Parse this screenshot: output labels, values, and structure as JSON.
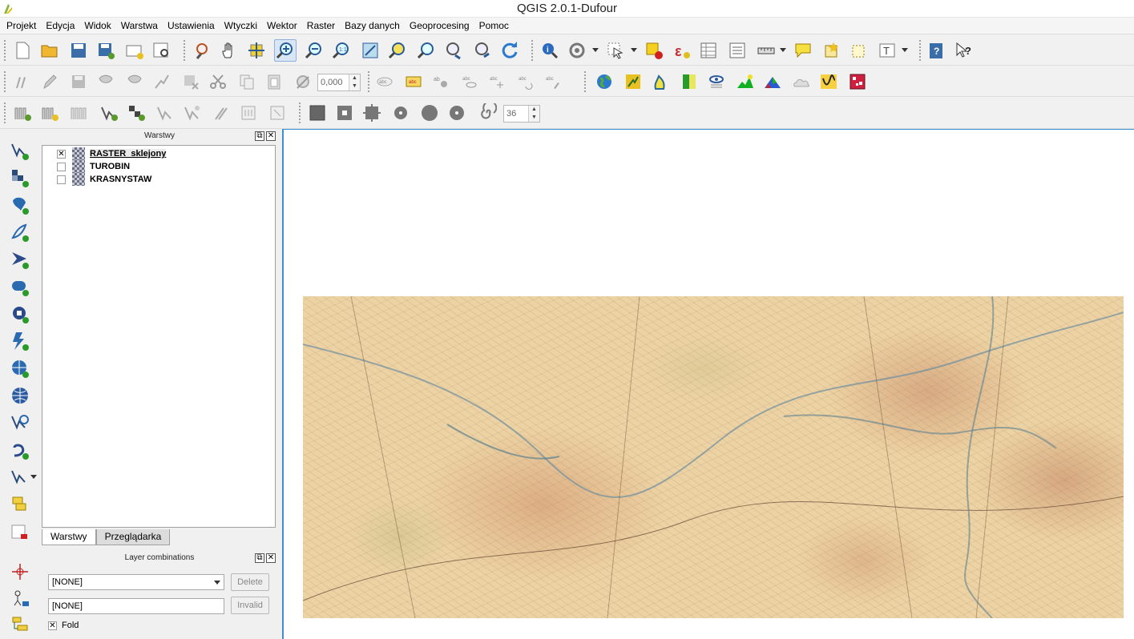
{
  "window": {
    "title": "QGIS 2.0.1-Dufour"
  },
  "menu": [
    "Projekt",
    "Edycja",
    "Widok",
    "Warstwa",
    "Ustawienia",
    "Wtyczki",
    "Wektor",
    "Raster",
    "Bazy danych",
    "Geoprocesing",
    "Pomoc"
  ],
  "toolbar": {
    "scale_value": "0,000",
    "segments_value": "36"
  },
  "layers_panel": {
    "title": "Warstwy",
    "layers": [
      {
        "name": "RASTER_sklejony",
        "checked": true,
        "mark": "✕"
      },
      {
        "name": "TUROBIN",
        "checked": false,
        "mark": ""
      },
      {
        "name": "KRASNYSTAW",
        "checked": false,
        "mark": ""
      }
    ],
    "tabs": [
      "Warstwy",
      "Przeglądarka"
    ]
  },
  "layer_combinations": {
    "title": "Layer combinations",
    "combo_value": "[NONE]",
    "field_value": "[NONE]",
    "delete_label": "Delete",
    "invalid_label": "Invalid",
    "fold_label": "Fold",
    "fold_mark": "✕"
  },
  "panel_buttons": {
    "float": "⧉",
    "close": "✕"
  },
  "colors": {
    "canvas_border": "#3c8fd6",
    "map_base": "#edd3a4"
  }
}
